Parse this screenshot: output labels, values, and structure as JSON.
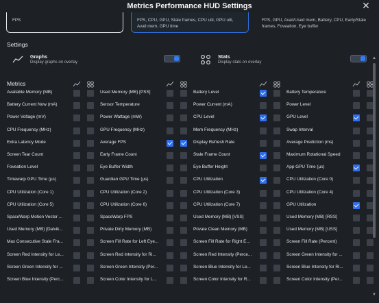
{
  "window": {
    "title": "Metrics Performance HUD Settings"
  },
  "presets": [
    {
      "text": "FPS",
      "selected": false
    },
    {
      "text": "FPS, CPU, GPU, Stale frames, CPU util, GPU util, Avail mem, GPU time",
      "selected": true
    },
    {
      "text": "FPS, GPU, Avail/Used mem, Battery, CPU, Early/Stale frames, Foveation, Eye buffer",
      "selected": false
    }
  ],
  "settings": {
    "title": "Settings",
    "graphs": {
      "title": "Graphs",
      "desc": "Display graphs on overlay",
      "on": true,
      "icon": "graph-icon"
    },
    "stats": {
      "title": "Stats",
      "desc": "Display stats on overlay",
      "on": true,
      "icon": "stats-icon"
    }
  },
  "metrics_title": "Metrics",
  "accent": "#2f6ff0",
  "columns": [
    [
      [
        "Available Memory (MB)",
        0,
        0
      ],
      [
        "Battery Current Now (mA)",
        0,
        0
      ],
      [
        "Power Voltage (mV)",
        0,
        0
      ],
      [
        "CPU Frequency (MHz)",
        0,
        0
      ],
      [
        "Extra Latency Mode",
        0,
        0
      ],
      [
        "Screen Tear Count",
        0,
        0
      ],
      [
        "Foveation Level",
        0,
        0
      ],
      [
        "Timewarp GPU Time (µs)",
        0,
        0
      ],
      [
        "CPU Utilization (Core 1)",
        0,
        0
      ],
      [
        "CPU Utilization (Core 5)",
        0,
        0
      ],
      [
        "SpaceWarp Motion Vector ...",
        0,
        0
      ],
      [
        "Used Memory (MB) [Dalvik...",
        0,
        0
      ],
      [
        "Max Consecutive Stale Fra...",
        0,
        0
      ],
      [
        "Screen Red Intensity for Le...",
        0,
        0
      ],
      [
        "Screen Green Intensity for ...",
        0,
        0
      ],
      [
        "Screen Blue Intensity (Perc...",
        0,
        0
      ]
    ],
    [
      [
        "Used Memory (MB) [PSS]",
        0,
        0
      ],
      [
        "Sensor Temperature",
        0,
        0
      ],
      [
        "Power Wattage (mW)",
        0,
        0
      ],
      [
        "GPU Frequency (MHz)",
        0,
        0
      ],
      [
        "Average FPS",
        1,
        1
      ],
      [
        "Early Frame Count",
        0,
        0
      ],
      [
        "Eye Buffer Width",
        0,
        0
      ],
      [
        "Guardian GPU Time (µs)",
        0,
        0
      ],
      [
        "CPU Utilization (Core 2)",
        0,
        0
      ],
      [
        "CPU Utilization (Core 6)",
        0,
        0
      ],
      [
        "SpaceWarp FPS",
        0,
        0
      ],
      [
        "Private Dirty Memory (MB)",
        0,
        0
      ],
      [
        "Screen Fill Rate for Left Eye...",
        0,
        0
      ],
      [
        "Screen Red Intensity for Ri...",
        0,
        0
      ],
      [
        "Screen Green Intensity (Per...",
        0,
        0
      ],
      [
        "Screen Color Intensity for L...",
        0,
        0
      ]
    ],
    [
      [
        "Battery Level",
        1,
        0
      ],
      [
        "Power Current (mA)",
        0,
        0
      ],
      [
        "CPU Level",
        1,
        0
      ],
      [
        "Mem Frequency (MHz)",
        0,
        0
      ],
      [
        "Display Refresh Rate",
        0,
        0
      ],
      [
        "Stale Frame Count",
        1,
        0
      ],
      [
        "Eye Buffer Height",
        0,
        0
      ],
      [
        "CPU Utilization",
        1,
        0
      ],
      [
        "CPU Utilization (Core 3)",
        0,
        0
      ],
      [
        "CPU Utilization (Core 7)",
        0,
        0
      ],
      [
        "Used Memory (MB) [VSS]",
        0,
        0
      ],
      [
        "Private Clean Memory (MB)",
        0,
        0
      ],
      [
        "Screen Fill Rate for Right E...",
        0,
        0
      ],
      [
        "Screen Red Intensity (Perce...",
        0,
        0
      ],
      [
        "Screen Blue Intensity for Le...",
        0,
        0
      ],
      [
        "Screen Color Intensity for R...",
        0,
        0
      ]
    ],
    [
      [
        "Battery Temperature",
        0,
        0
      ],
      [
        "Power Level",
        0,
        0
      ],
      [
        "GPU Level",
        1,
        0
      ],
      [
        "Swap Interval",
        0,
        0
      ],
      [
        "Average Prediction (ms)",
        0,
        0
      ],
      [
        "Maximum Rotational Speed",
        0,
        0
      ],
      [
        "App GPU Time (µs)",
        1,
        0
      ],
      [
        "CPU Utilization (Core 0)",
        0,
        0
      ],
      [
        "CPU Utilization (Core 4)",
        0,
        0
      ],
      [
        "GPU Utilization",
        1,
        0
      ],
      [
        "Used Memory (MB) [RSS]",
        0,
        0
      ],
      [
        "Used Memory (MB) [USS]",
        0,
        0
      ],
      [
        "Screen Fill Rate (Percent)",
        0,
        0
      ],
      [
        "Screen Green Intensity for ...",
        0,
        0
      ],
      [
        "Screen Blue Intensity for Ri...",
        0,
        0
      ],
      [
        "Screen Color Intensity (Per...",
        0,
        0
      ]
    ]
  ]
}
